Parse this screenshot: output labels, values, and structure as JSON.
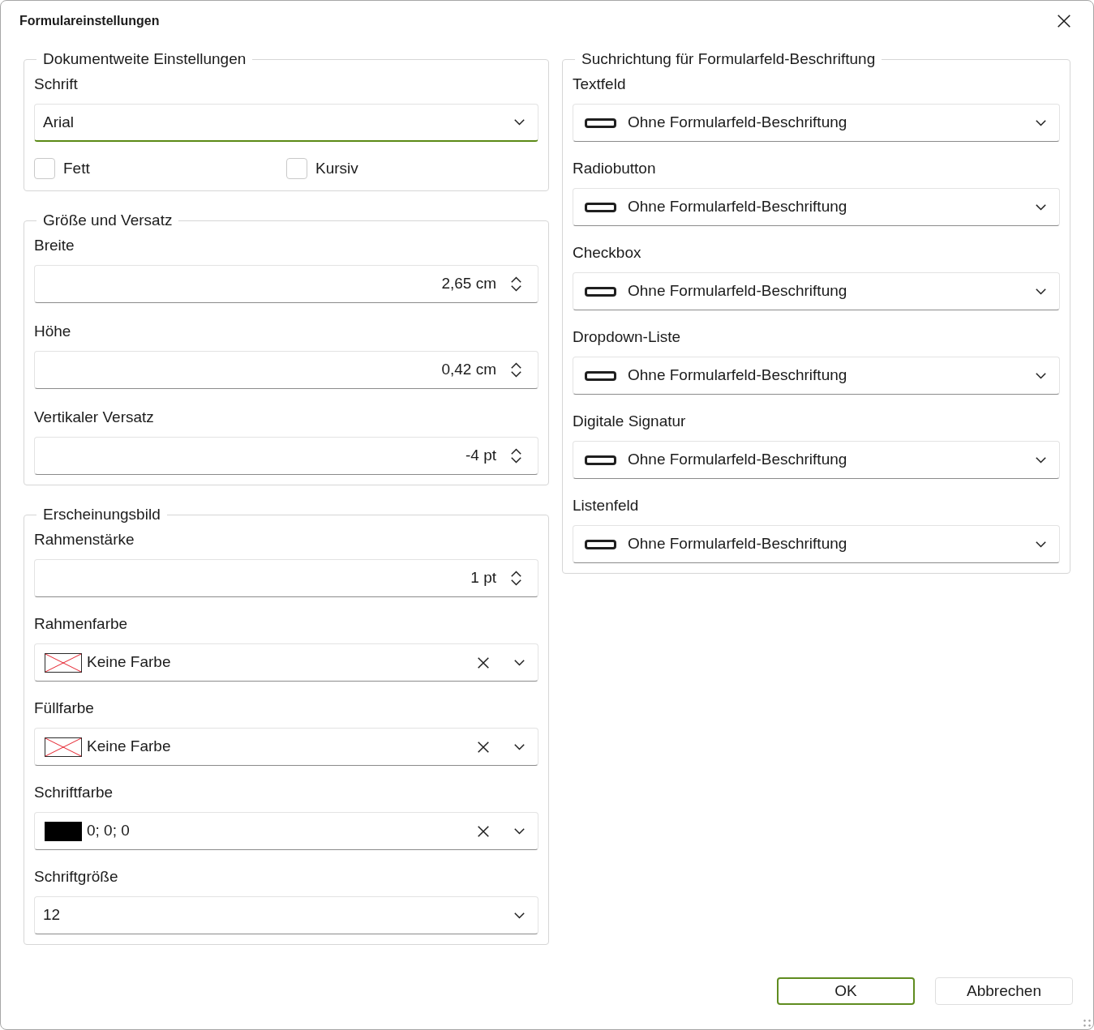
{
  "window": {
    "title": "Formulareinstellungen"
  },
  "columns": [
    {
      "groups": [
        {
          "title": "Dokumentweite Einstellungen",
          "fields": [
            {
              "kind": "dropdown",
              "label": "Schrift",
              "value": "Arial",
              "focused": true
            },
            {
              "kind": "checkboxes",
              "options": [
                {
                  "label": "Fett",
                  "checked": false
                },
                {
                  "label": "Kursiv",
                  "checked": false
                }
              ]
            }
          ]
        },
        {
          "title": "Größe und Versatz",
          "fields": [
            {
              "kind": "spin",
              "label": "Breite",
              "value": "2,65 cm",
              "focused": false
            },
            {
              "kind": "spin",
              "label": "Höhe",
              "value": "0,42 cm",
              "focused": false
            },
            {
              "kind": "spin",
              "label": "Vertikaler Versatz",
              "value": "-4 pt",
              "focused": false
            }
          ]
        },
        {
          "title": "Erscheinungsbild",
          "fields": [
            {
              "kind": "spin",
              "label": "Rahmenstärke",
              "value": "1 pt",
              "focused": false
            },
            {
              "kind": "color",
              "label": "Rahmenfarbe",
              "no_color": true,
              "value": "Keine Farbe",
              "focused": false
            },
            {
              "kind": "color",
              "label": "Füllfarbe",
              "no_color": true,
              "value": "Keine Farbe",
              "focused": false
            },
            {
              "kind": "color",
              "label": "Schriftfarbe",
              "no_color": false,
              "color": "#000000",
              "value": "0; 0; 0",
              "focused": false
            },
            {
              "kind": "dropdown",
              "label": "Schriftgröße",
              "value": "12",
              "focused": false
            }
          ]
        }
      ]
    },
    {
      "groups": [
        {
          "title": "Suchrichtung für Formularfeld-Beschriftung",
          "fields": [
            {
              "kind": "placement",
              "label": "Textfeld",
              "value": "Ohne Formularfeld-Beschriftung",
              "focused": false
            },
            {
              "kind": "placement",
              "label": "Radiobutton",
              "value": "Ohne Formularfeld-Beschriftung",
              "focused": false
            },
            {
              "kind": "placement",
              "label": "Checkbox",
              "value": "Ohne Formularfeld-Beschriftung",
              "focused": false
            },
            {
              "kind": "placement",
              "label": "Dropdown-Liste",
              "value": "Ohne Formularfeld-Beschriftung",
              "focused": false
            },
            {
              "kind": "placement",
              "label": "Digitale Signatur",
              "value": "Ohne Formularfeld-Beschriftung",
              "focused": false
            },
            {
              "kind": "placement",
              "label": "Listenfeld",
              "value": "Ohne Formularfeld-Beschriftung",
              "focused": false
            }
          ]
        }
      ]
    }
  ],
  "buttons": [
    {
      "label": "OK",
      "default": true
    },
    {
      "label": "Abbrechen",
      "default": false
    }
  ]
}
